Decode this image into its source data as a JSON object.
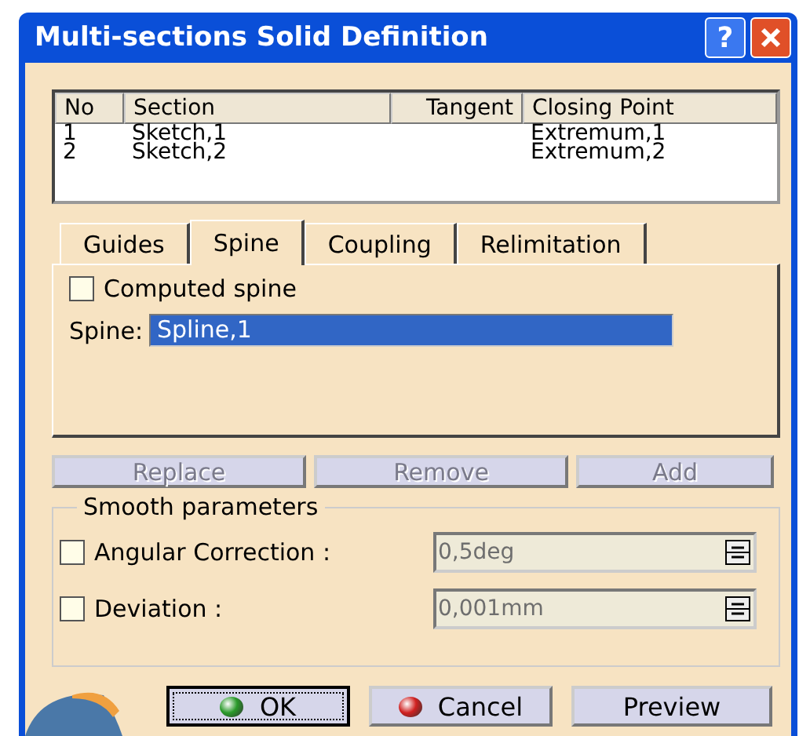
{
  "window": {
    "title": "Multi-sections Solid Definition",
    "help": "?"
  },
  "table": {
    "columns": [
      "No",
      "Section",
      "Tangent",
      "Closing Point"
    ],
    "rows": [
      {
        "cells": [
          "1",
          "Sketch,1",
          "",
          "Extremum,1"
        ],
        "selected": false
      },
      {
        "cells": [
          "2",
          "Sketch,2",
          "",
          "Extremum,2"
        ],
        "selected": false
      }
    ]
  },
  "tabs": [
    {
      "label": "Guides",
      "selected": false
    },
    {
      "label": "Spine",
      "selected": true
    },
    {
      "label": "Coupling",
      "selected": false
    },
    {
      "label": "Relimitation",
      "selected": false
    }
  ],
  "spine_panel": {
    "computed_spine": {
      "label": "Computed spine",
      "checked": false
    },
    "spine": {
      "label": "Spine:",
      "value": "Spline,1",
      "selected": true
    }
  },
  "actions": [
    {
      "label": "Replace",
      "disabled": true
    },
    {
      "label": "Remove",
      "disabled": true
    },
    {
      "label": "Add",
      "disabled": true
    }
  ],
  "smooth": {
    "title": "Smooth parameters",
    "rows": [
      {
        "label": "Angular Correction :",
        "checked": false,
        "value": "0,5deg",
        "disabled": true
      },
      {
        "label": "Deviation :",
        "checked": false,
        "value": "0,001mm",
        "disabled": true
      }
    ]
  },
  "buttons": [
    {
      "label": "OK",
      "kind": "ok",
      "default": true
    },
    {
      "label": "Cancel",
      "kind": "cancel",
      "default": false
    },
    {
      "label": "Preview",
      "kind": "plain",
      "default": false
    }
  ]
}
